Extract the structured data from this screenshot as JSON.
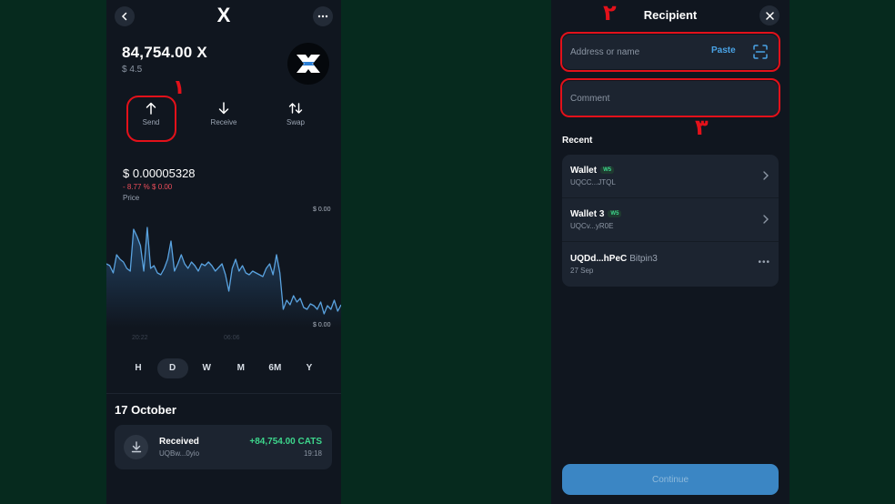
{
  "left_screen": {
    "title": "X",
    "balance": "84,754.00 X",
    "fiat_balance": "$ 4.5",
    "actions": [
      {
        "label": "Send",
        "icon": "arrow-up-icon"
      },
      {
        "label": "Receive",
        "icon": "arrow-down-icon"
      },
      {
        "label": "Swap",
        "icon": "swap-icon"
      }
    ],
    "price": "$ 0.00005328",
    "price_change": "- 8.77 % $ 0.00",
    "price_label": "Price",
    "chart_axis_top": "$ 0.00",
    "chart_axis_bottom": "$ 0.00",
    "chart_time_labels": [
      "20:22",
      "06:06"
    ],
    "periods": [
      "H",
      "D",
      "W",
      "M",
      "6M",
      "Y"
    ],
    "active_period": "D",
    "history_date": "17 October",
    "transaction": {
      "title": "Received",
      "address": "UQBw...0yio",
      "amount": "+84,754.00 CATS",
      "time": "19:18"
    }
  },
  "right_screen": {
    "title": "Recipient",
    "address_placeholder": "Address or name",
    "paste_label": "Paste",
    "comment_placeholder": "Comment",
    "recent_label": "Recent",
    "recent": [
      {
        "name": "Wallet",
        "badge": "W5",
        "sub": "",
        "address": "UQCC...JTQL",
        "trail": "chevron"
      },
      {
        "name": "Wallet 3",
        "badge": "W5",
        "sub": "",
        "address": "UQCv...yR0E",
        "trail": "chevron"
      },
      {
        "name": "UQDd...hPeC",
        "badge": "",
        "sub": "Bitpin3",
        "address": "27 Sep",
        "trail": "more"
      }
    ],
    "continue_label": "Continue"
  },
  "annotations": [
    "١",
    "٢",
    "٣"
  ],
  "colors": {
    "background": "#062a1e",
    "panel": "#10161f",
    "card": "#1c2430",
    "accent_blue": "#4aa3e6",
    "positive": "#3dd68c",
    "negative": "#ef4e5b",
    "annotation_red": "#e3111a"
  }
}
